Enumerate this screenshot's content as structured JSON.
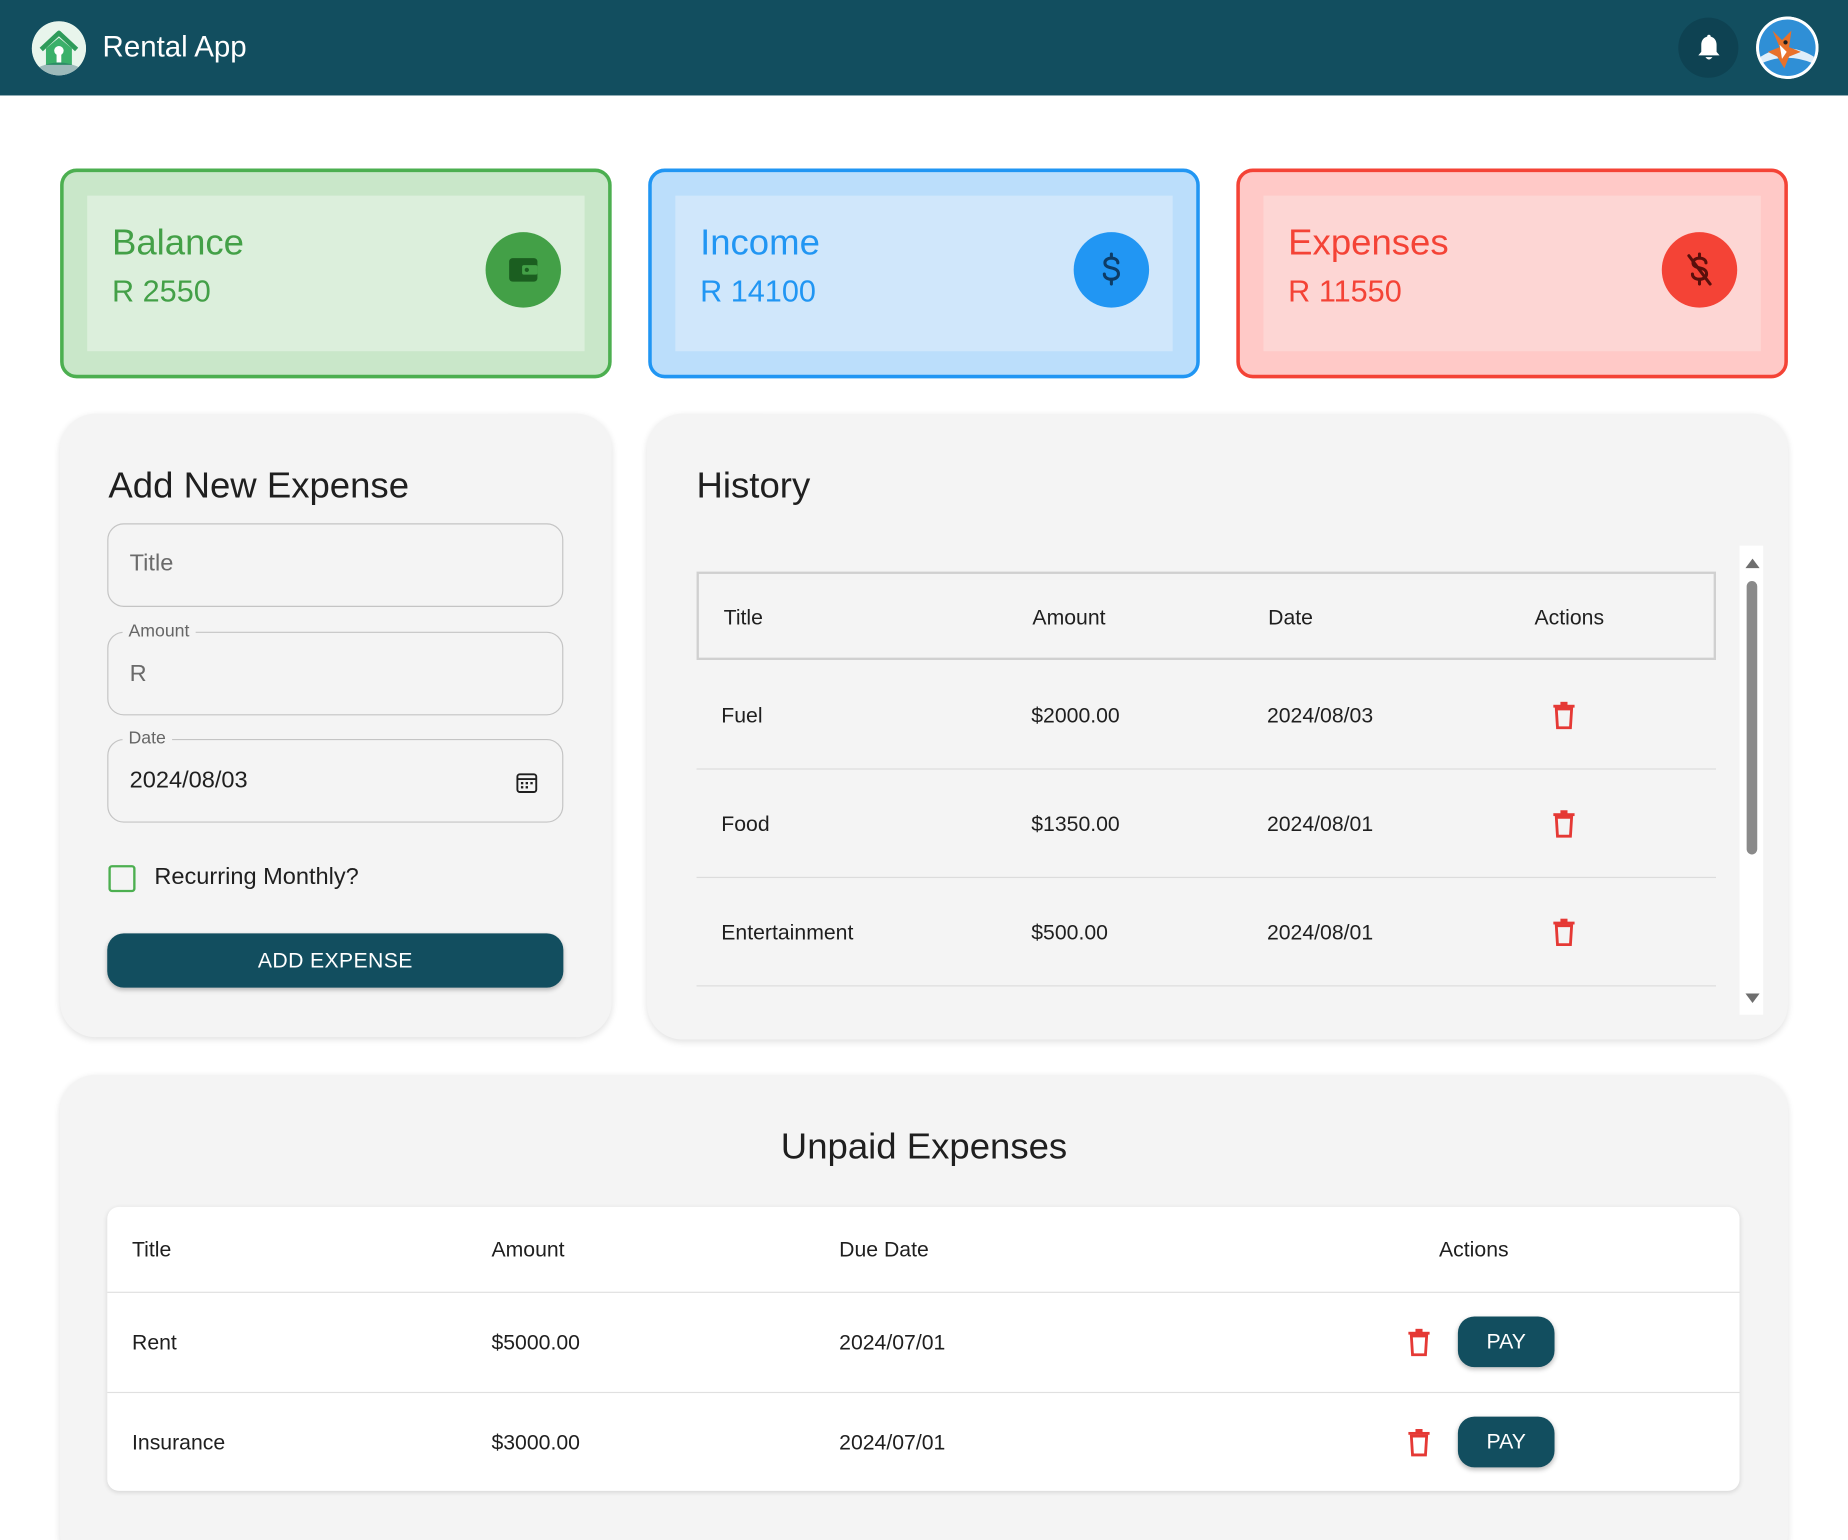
{
  "header": {
    "app_title": "Rental App",
    "logo_icon": "house-keyhole-logo",
    "notification_icon": "bell-icon",
    "avatar": "user-avatar-fox",
    "bar_color": "#124e5f"
  },
  "stats": {
    "balance": {
      "label": "Balance",
      "value": "R 2550",
      "icon": "wallet-icon",
      "color": "#43a047"
    },
    "income": {
      "label": "Income",
      "value": "R 14100",
      "icon": "dollar-icon",
      "color": "#2196f3"
    },
    "expenses": {
      "label": "Expenses",
      "value": "R 11550",
      "icon": "money-off-icon",
      "color": "#f44336"
    }
  },
  "add_expense": {
    "title": "Add New Expense",
    "title_field": {
      "placeholder": "Title",
      "value": ""
    },
    "amount_field": {
      "label": "Amount",
      "value": "R"
    },
    "date_field": {
      "label": "Date",
      "value": "2024/08/03",
      "icon": "calendar-icon"
    },
    "recurring_label": "Recurring Monthly?",
    "recurring_checked": false,
    "submit_label": "ADD EXPENSE"
  },
  "history": {
    "title": "History",
    "columns": [
      "Title",
      "Amount",
      "Date",
      "Actions"
    ],
    "rows": [
      {
        "title": "Fuel",
        "amount": "$2000.00",
        "date": "2024/08/03",
        "action_icon": "trash-icon"
      },
      {
        "title": "Food",
        "amount": "$1350.00",
        "date": "2024/08/01",
        "action_icon": "trash-icon"
      },
      {
        "title": "Entertainment",
        "amount": "$500.00",
        "date": "2024/08/01",
        "action_icon": "trash-icon"
      }
    ]
  },
  "unpaid": {
    "title": "Unpaid Expenses",
    "columns": [
      "Title",
      "Amount",
      "Due Date",
      "Actions"
    ],
    "rows": [
      {
        "title": "Rent",
        "amount": "$5000.00",
        "due_date": "2024/07/01",
        "pay_label": "PAY",
        "action_icon": "trash-icon"
      },
      {
        "title": "Insurance",
        "amount": "$3000.00",
        "due_date": "2024/07/01",
        "pay_label": "PAY",
        "action_icon": "trash-icon"
      }
    ]
  }
}
